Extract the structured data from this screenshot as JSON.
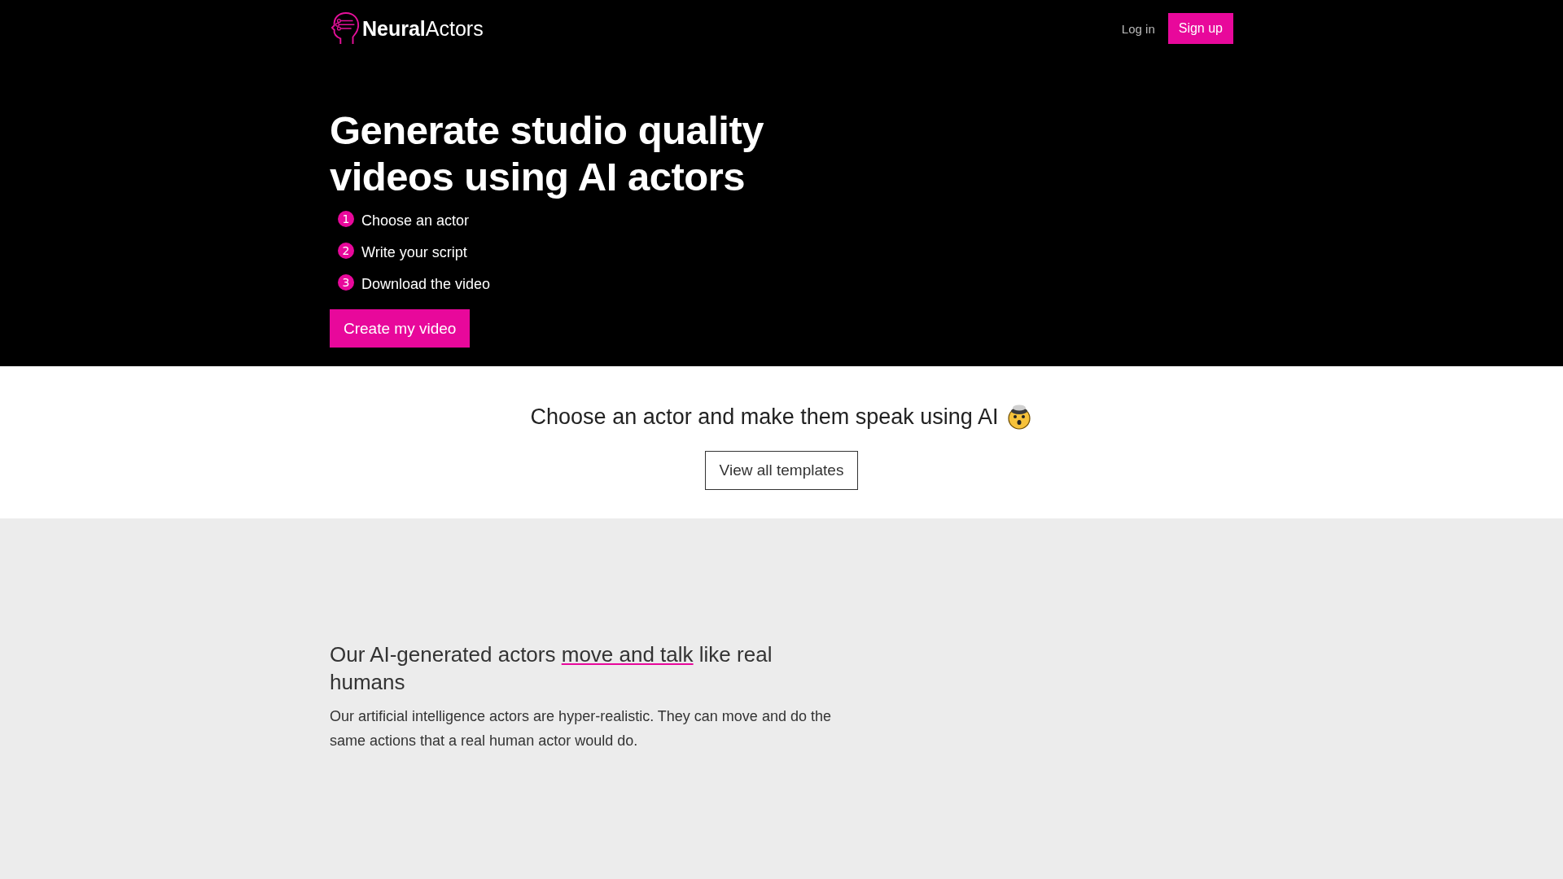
{
  "header": {
    "logo": {
      "bold": "Neural",
      "light": "Actors"
    },
    "login": "Log in",
    "signup": "Sign up"
  },
  "hero": {
    "title": "Generate studio quality videos using AI actors",
    "steps": [
      {
        "number": "1",
        "label": "Choose an actor"
      },
      {
        "number": "2",
        "label": "Write your script"
      },
      {
        "number": "3",
        "label": "Download the video"
      }
    ],
    "cta": "Create my video"
  },
  "templates": {
    "heading": "Choose an actor and make them speak using AI",
    "button": "View all templates"
  },
  "feature": {
    "heading_before": "Our AI-generated actors ",
    "heading_link": "move and talk",
    "heading_after": " like real humans",
    "text": "Our artificial intelligence actors are hyper-realistic. They can move and do the same actions that a real human actor would do."
  }
}
